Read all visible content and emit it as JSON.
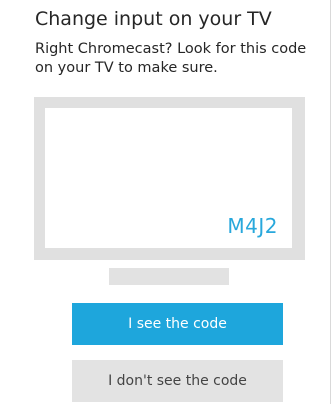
{
  "title": "Change input on your TV",
  "subtitle": "Right Chromecast? Look for this code on your TV to make sure.",
  "tv": {
    "code": "M4J2"
  },
  "buttons": {
    "see_code": "I see the code",
    "dont_see_code": "I don't see the code"
  },
  "colors": {
    "accent": "#1ea6dc",
    "code_text": "#28a8dc",
    "tv_frame": "#e0e0e0",
    "secondary_button": "#e3e3e3"
  }
}
